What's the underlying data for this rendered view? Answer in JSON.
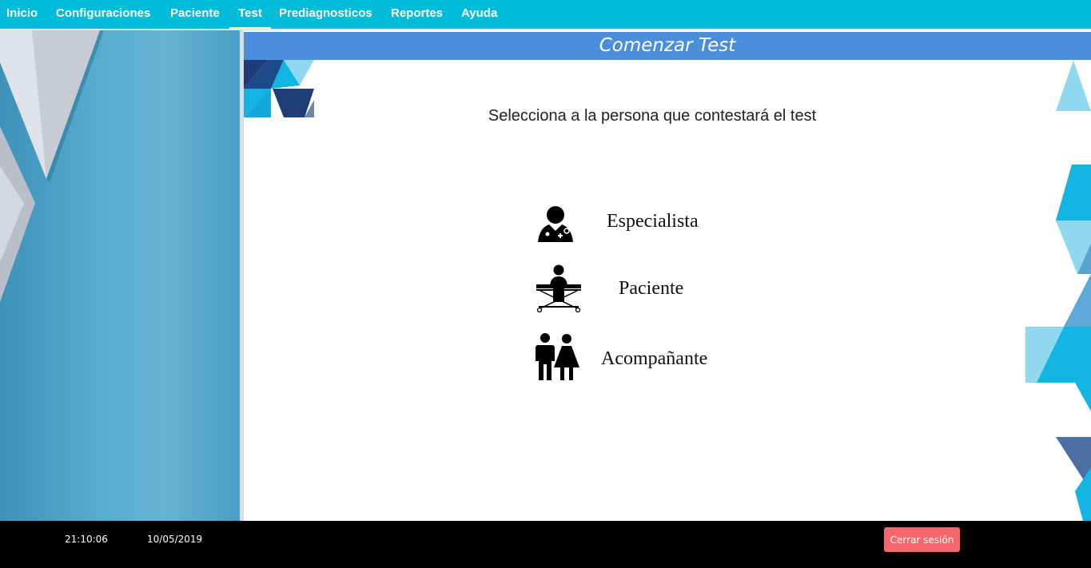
{
  "nav": {
    "items": [
      {
        "label": "Inicio"
      },
      {
        "label": "Configuraciones"
      },
      {
        "label": "Paciente"
      },
      {
        "label": "Test"
      },
      {
        "label": "Prediagnosticos"
      },
      {
        "label": "Reportes"
      },
      {
        "label": "Ayuda"
      }
    ],
    "active": "Test"
  },
  "header": {
    "title": "Comenzar Test"
  },
  "main": {
    "instruction": "Selecciona a la persona que contestará el test",
    "options": [
      {
        "label": "Especialista",
        "icon": "doctor-icon"
      },
      {
        "label": "Paciente",
        "icon": "patient-on-bed-icon"
      },
      {
        "label": "Acompañante",
        "icon": "man-woman-couple-icon"
      }
    ]
  },
  "status": {
    "time": "21:10:06",
    "date": "10/05/2019",
    "logout_label": "Cerrar sesión"
  },
  "colors": {
    "nav_bg": "#00bcd8",
    "header_bg": "#4b8fdc",
    "logout_bg": "#f4676b",
    "statusbar_bg": "#000000"
  }
}
